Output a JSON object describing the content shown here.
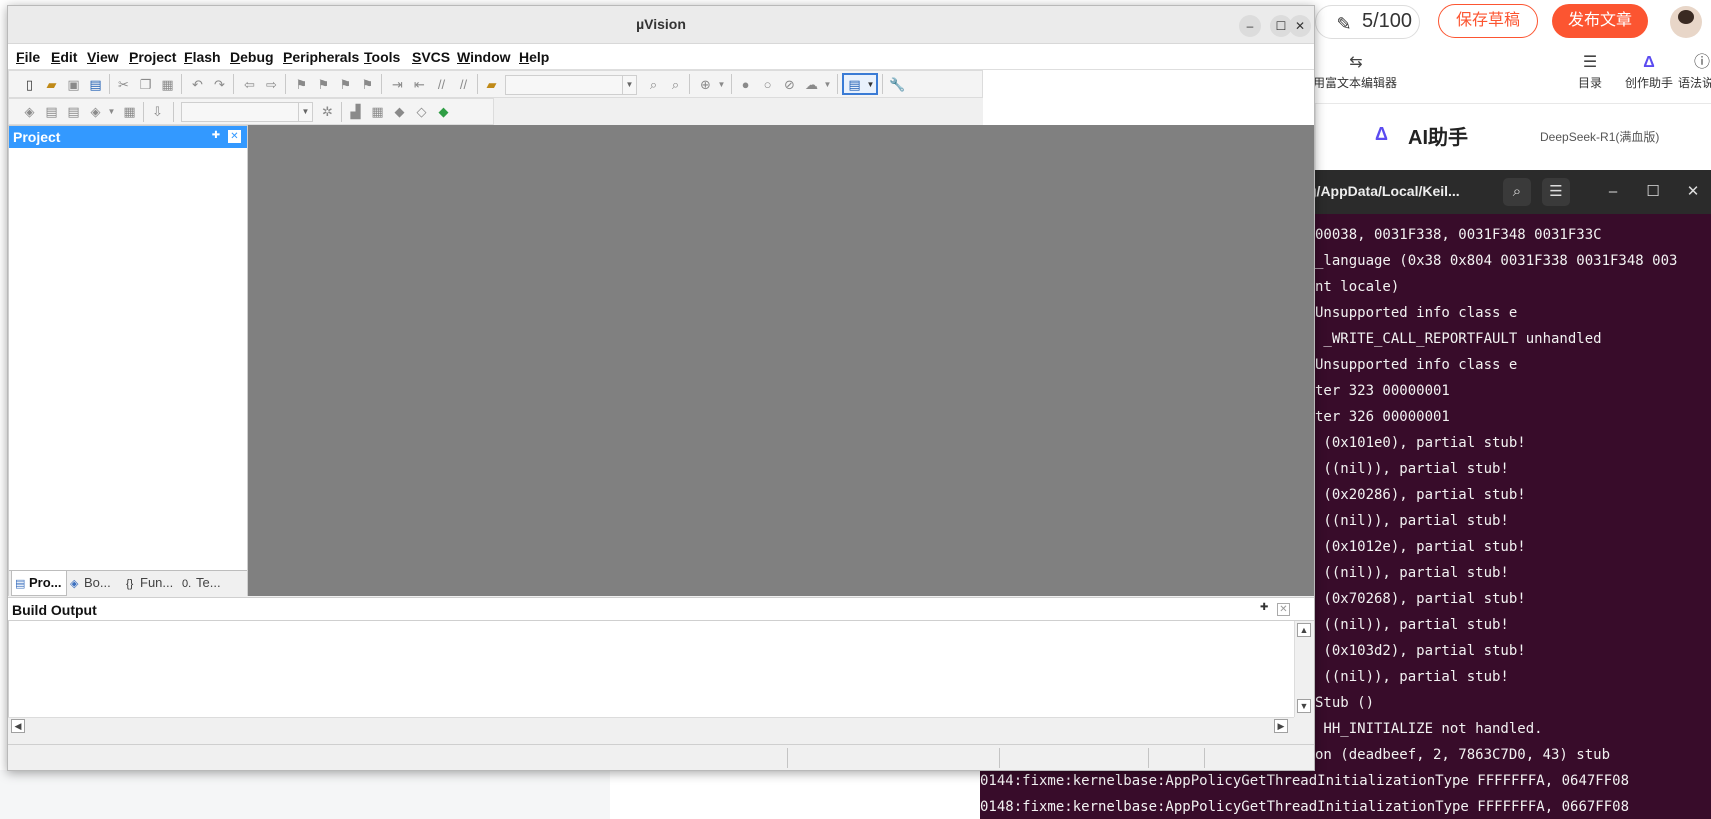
{
  "browser_editor": {
    "word_counter": "5/100",
    "save_draft_label": "保存草稿",
    "publish_label": "发布文章",
    "rich_text_label": "使用富文本编辑器",
    "toc_label": "目录",
    "assistant_label": "创作助手",
    "syntax_label": "语法说明",
    "ai_title": "AI助手",
    "ai_model": "DeepSeek-R1(满血版)"
  },
  "terminal": {
    "title": "g/AppData/Local/Keil...",
    "lines": [
      "00038, 0031F338, 0031F348 0031F33C",
      "_language (0x38 0x804 0031F338 0031F348 003",
      "nt locale)",
      "Unsupported info class e",
      " _WRITE_CALL_REPORTFAULT unhandled",
      "Unsupported info class e",
      "ter 323 00000001",
      "ter 326 00000001",
      " (0x101e0), partial stub!",
      " ((nil)), partial stub!",
      " (0x20286), partial stub!",
      " ((nil)), partial stub!",
      " (0x1012e), partial stub!",
      " ((nil)), partial stub!",
      " (0x70268), partial stub!",
      " ((nil)), partial stub!",
      " (0x103d2), partial stub!",
      " ((nil)), partial stub!",
      "Stub ()",
      " HH_INITIALIZE not handled.",
      "on (deadbeef, 2, 7863C7D0, 43) stub"
    ],
    "full_lines": [
      "0144:fixme:kernelbase:AppPolicyGetThreadInitializationType FFFFFFFA, 0647FF08",
      "0148:fixme:kernelbase:AppPolicyGetThreadInitializationType FFFFFFFA, 0667FF08"
    ]
  },
  "window": {
    "title": "µVision",
    "menu": [
      {
        "label": "File",
        "ul": "F",
        "rest": "ile"
      },
      {
        "label": "Edit",
        "ul": "E",
        "rest": "dit"
      },
      {
        "label": "View",
        "ul": "V",
        "rest": "iew"
      },
      {
        "label": "Project",
        "ul": "P",
        "rest": "roject"
      },
      {
        "label": "Flash",
        "ul": "F",
        "rest": "lash"
      },
      {
        "label": "Debug",
        "ul": "D",
        "rest": "ebug"
      },
      {
        "label": "Peripherals",
        "ul": "P",
        "rest": "eripherals"
      },
      {
        "label": "Tools",
        "ul": "T",
        "rest": "ools"
      },
      {
        "label": "SVCS",
        "ul": "S",
        "rest": "VCS"
      },
      {
        "label": "Window",
        "ul": "W",
        "rest": "indow"
      },
      {
        "label": "Help",
        "ul": "H",
        "rest": "elp"
      }
    ]
  },
  "project_panel": {
    "title": "Project",
    "tabs": [
      "Pro...",
      "Bo...",
      "Fun...",
      "Te..."
    ]
  },
  "build_output": {
    "title": "Build Output"
  }
}
